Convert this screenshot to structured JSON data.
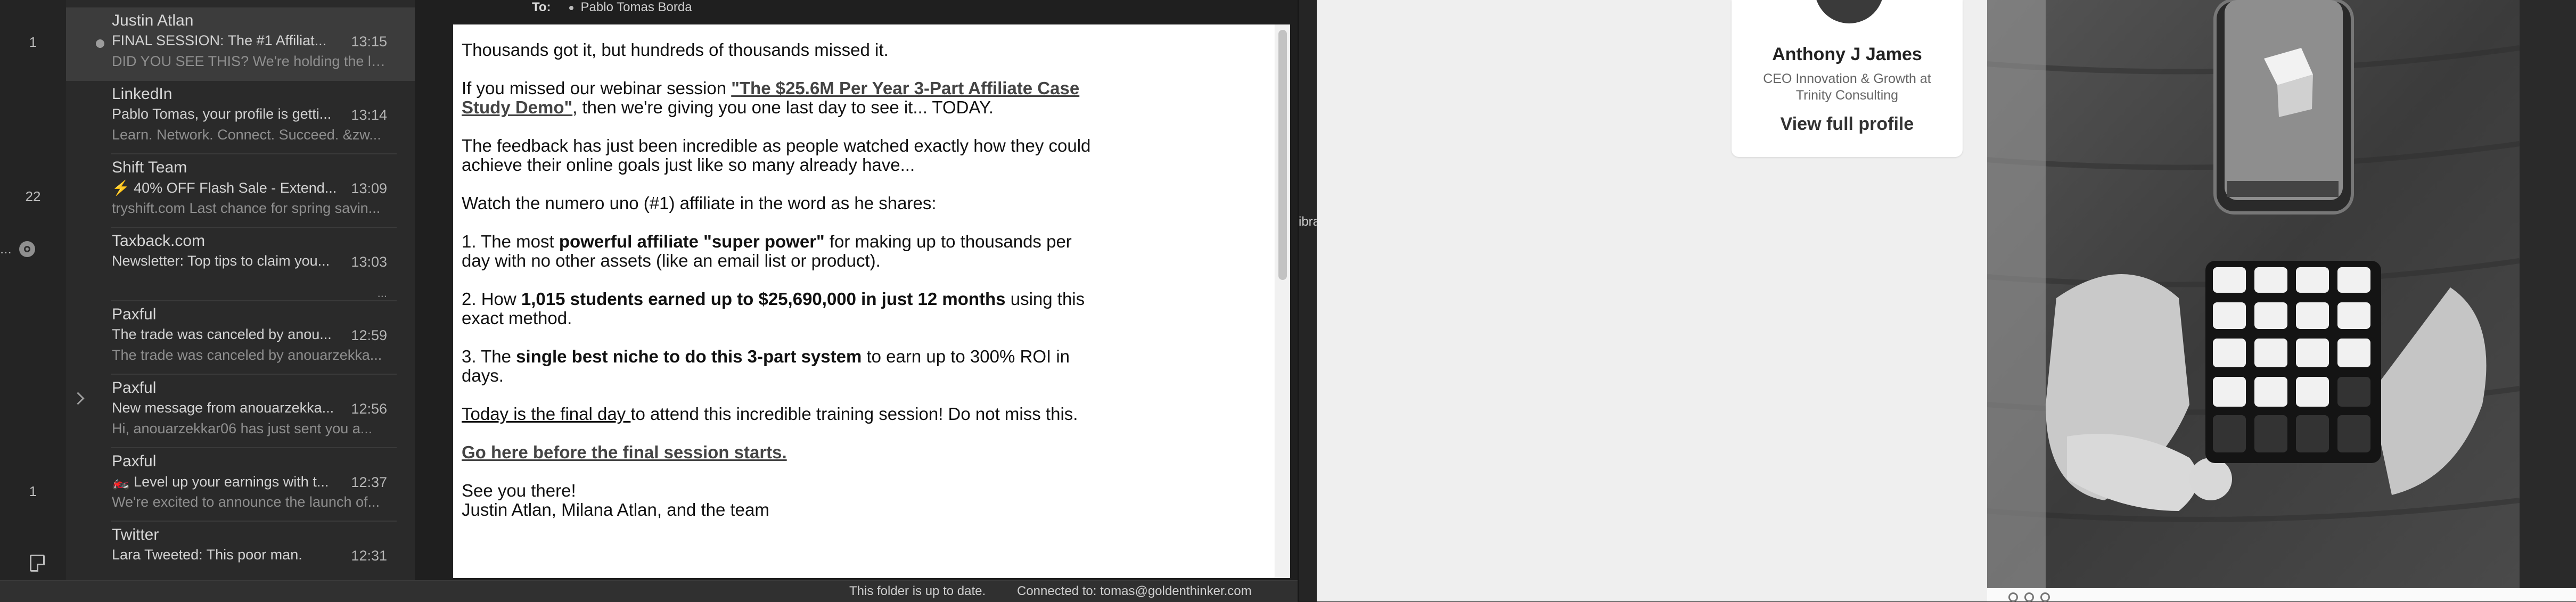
{
  "rail": {
    "counts": [
      "1",
      "22",
      "1"
    ],
    "ellipsis": "..."
  },
  "messages": [
    {
      "sender": "Justin Atlan",
      "subject": "FINAL SESSION: The #1 Affiliat...",
      "time": "13:15",
      "preview": "DID YOU SEE THIS? We're holding the la...",
      "unread": true,
      "selected": true
    },
    {
      "sender": "LinkedIn",
      "subject": "Pablo Tomas, your profile is getti...",
      "time": "13:14",
      "preview": "Learn. Network. Connect. Succeed. &zw..."
    },
    {
      "sender": "Shift Team",
      "subject": "⚡ 40% OFF Flash Sale - Extend...",
      "time": "13:09",
      "preview": "tryshift.com Last chance for spring savin..."
    },
    {
      "sender": "Taxback.com",
      "subject": "Newsletter: Top tips to claim you...",
      "time": "13:03",
      "preview": "",
      "more": "..."
    },
    {
      "sender": "Paxful",
      "subject": "The trade was canceled by anou...",
      "time": "12:59",
      "preview": "The trade was canceled by anouarzekka..."
    },
    {
      "sender": "Paxful",
      "subject": "New message from anouarzekka...",
      "time": "12:56",
      "preview": "Hi, anouarzekkar06 has just sent you a...",
      "thread": true
    },
    {
      "sender": "Paxful",
      "subject": "🏍️ Level up your earnings with t...",
      "time": "12:37",
      "preview": "We're excited to announce the launch of..."
    },
    {
      "sender": "Twitter",
      "subject": "Lara Tweeted: This poor man.",
      "time": "12:31",
      "preview": ""
    }
  ],
  "header": {
    "to_label": "To:",
    "to_value": "Pablo Tomas Borda"
  },
  "email": {
    "p1": "Thousands got it, but hundreds of thousands missed it.",
    "p2_a": "If you missed our webinar session ",
    "p2_link": "\"The $25.6M Per Year 3-Part Affiliate Case Study Demo\"",
    "p2_b": ", then we're giving you one last day to see it... TODAY.",
    "p3": "The feedback has just been incredible as people watched exactly how they could achieve their online goals just like so many already have...",
    "p4": "Watch the numero uno (#1) affiliate in the word as he shares:",
    "l1_a": "1. The most ",
    "l1_b": "powerful affiliate \"super power\"",
    "l1_c": " for making up to thousands per day with no other assets (like an email list or product).",
    "l2_a": "2. How ",
    "l2_b": "1,015 students earned up to $25,690,000 in just 12 months",
    "l2_c": " using this exact method.",
    "l3_a": "3. The ",
    "l3_b": "single best niche to do this 3-part system",
    "l3_c": " to earn up to 300% ROI in days.",
    "p5_u": "Today is the final day ",
    "p5_b": "to attend this incredible training session! Do not miss this.",
    "cta": "Go here before the final session starts.",
    "sig1": "See you there!",
    "sig2": "Justin Atlan, Milana Atlan, and the team"
  },
  "status": {
    "left": "This folder is up to date.",
    "right": "Connected to: tomas@goldenthinker.com"
  },
  "divider_label": "ibra",
  "profile_card": {
    "name": "Anthony J James",
    "headline": "CEO Innovation & Growth at Trinity Consulting",
    "link": "View full profile"
  },
  "colors": {
    "list_bg": "#2a2a2a",
    "selected_bg": "#3c3c3c",
    "page_bg": "#efefef"
  }
}
